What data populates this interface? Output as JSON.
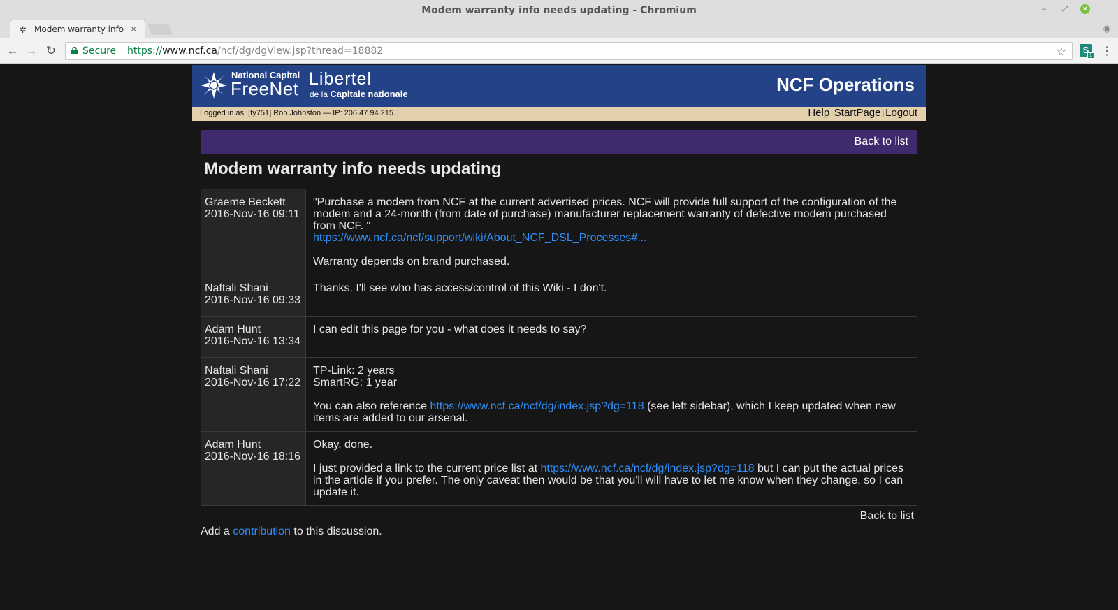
{
  "window": {
    "title": "Modem warranty info needs updating - Chromium"
  },
  "tab": {
    "title": "Modem warranty info n"
  },
  "address": {
    "secure_label": "Secure",
    "scheme": "https://",
    "host": "www.ncf.ca",
    "path": "/ncf/dg/dgView.jsp?thread=18882"
  },
  "extension": {
    "letter": "S",
    "badge": "1"
  },
  "banner": {
    "ncf_small": "National Capital",
    "ncf_big": "FreeNet",
    "lib_big": "Libertel",
    "lib_small_pre": "de la",
    "lib_small_bold": "Capitale nationale",
    "title": "NCF Operations"
  },
  "userbar": {
    "who": "Logged in as: [fy751] Rob Johnston — IP: 206.47.94.215",
    "help": "Help",
    "startpage": "StartPage",
    "logout": "Logout",
    "separator": "|"
  },
  "nav": {
    "back_to_list": "Back to list"
  },
  "thread": {
    "title": "Modem warranty info needs updating",
    "posts": [
      {
        "author": "Graeme Beckett",
        "date": "2016-Nov-16 09:11",
        "p1": "\"Purchase a modem from NCF at the current advertised prices. NCF will provide full support of the configuration of the modem and a 24-month (from date of purchase) manufacturer replacement warranty of defective modem purchased from NCF. \"",
        "link": "https://www.ncf.ca/ncf/support/wiki/About_NCF_DSL_Processes#...",
        "p2": "Warranty depends on brand purchased."
      },
      {
        "author": "Naftali Shani",
        "date": "2016-Nov-16 09:33",
        "p1": "Thanks. I'll see who has access/control of this Wiki - I don't."
      },
      {
        "author": "Adam Hunt",
        "date": "2016-Nov-16 13:34",
        "p1": "I can edit this page for you - what does it needs to say?"
      },
      {
        "author": "Naftali Shani",
        "date": "2016-Nov-16 17:22",
        "line1": "TP-Link: 2 years",
        "line2": "SmartRG: 1 year",
        "p2_pre": "You can also reference ",
        "link": "https://www.ncf.ca/ncf/dg/index.jsp?dg=118",
        "p2_post": " (see left sidebar), which I keep updated when new items are added to our arsenal."
      },
      {
        "author": "Adam Hunt",
        "date": "2016-Nov-16 18:16",
        "p1": "Okay, done.",
        "p2_pre": "I just provided a link to the current price list at ",
        "link": "https://www.ncf.ca/ncf/dg/index.jsp?dg=118",
        "p2_post": " but I can put the actual prices in the article if you prefer. The only caveat then would be that you'll will have to let me know when they change, so I can update it."
      }
    ]
  },
  "footer": {
    "back_to_list": "Back to list",
    "add_pre": "Add a ",
    "add_link": "contribution",
    "add_post": " to this discussion."
  }
}
